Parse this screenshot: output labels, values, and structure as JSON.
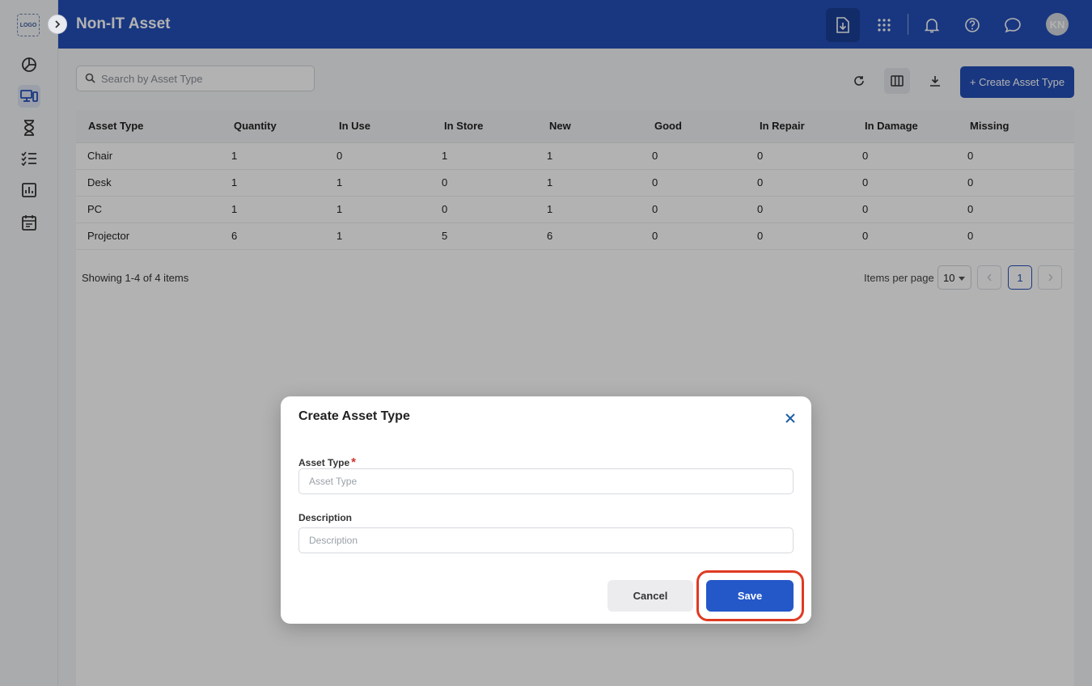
{
  "sidebar": {
    "logo": "LOGO",
    "icons": [
      "dashboard-icon",
      "devices-icon",
      "hourglass-icon",
      "checklist-icon",
      "report-chart-icon",
      "calendar-icon"
    ]
  },
  "header": {
    "title": "Non-IT Asset",
    "avatar_initials": "KN",
    "icons": [
      "file-import-icon",
      "apps-grid-icon",
      "bell-icon",
      "help-icon",
      "chat-icon"
    ]
  },
  "toolbar": {
    "search_placeholder": "Search by Asset Type",
    "create_label": "+ Create Asset Type"
  },
  "table": {
    "columns": [
      "Asset Type",
      "Quantity",
      "In Use",
      "In Store",
      "New",
      "Good",
      "In Repair",
      "In Damage",
      "Missing"
    ],
    "rows": [
      [
        "Chair",
        "1",
        "0",
        "1",
        "1",
        "0",
        "0",
        "0",
        "0"
      ],
      [
        "Desk",
        "1",
        "1",
        "0",
        "1",
        "0",
        "0",
        "0",
        "0"
      ],
      [
        "PC",
        "1",
        "1",
        "0",
        "1",
        "0",
        "0",
        "0",
        "0"
      ],
      [
        "Projector",
        "6",
        "1",
        "5",
        "6",
        "0",
        "0",
        "0",
        "0"
      ]
    ]
  },
  "pagination": {
    "showing": "Showing 1-4 of 4 items",
    "items_per_page_label": "Items per page",
    "items_per_page": "10",
    "current_page": "1"
  },
  "modal": {
    "title": "Create Asset Type",
    "asset_type_label": "Asset Type",
    "required_mark": "*",
    "asset_type_placeholder": "Asset Type",
    "description_label": "Description",
    "description_placeholder": "Description",
    "cancel_label": "Cancel",
    "save_label": "Save"
  },
  "colors": {
    "brand": "#2550b8",
    "save": "#2458c9",
    "highlight": "#e03a22"
  }
}
